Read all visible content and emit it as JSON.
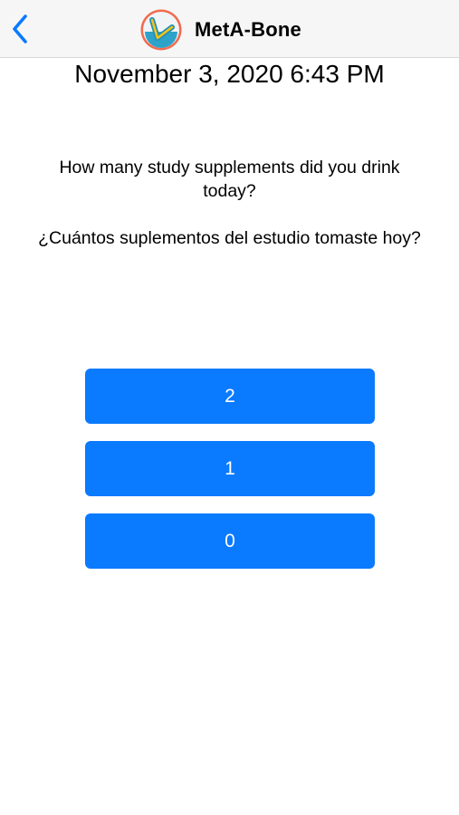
{
  "header": {
    "title": "MetA-Bone",
    "back_icon": "chevron-left-icon",
    "logo_icon": "meta-bone-logo",
    "accent_color": "#0a7aff"
  },
  "survey": {
    "timestamp": "November 3, 2020 6:43 PM",
    "question_en": "How many study supplements did you drink today?",
    "question_es": "¿Cuántos suplementos del estudio tomaste hoy?",
    "answers": [
      {
        "label": "2"
      },
      {
        "label": "1"
      },
      {
        "label": "0"
      }
    ],
    "button_color": "#0a7aff"
  }
}
